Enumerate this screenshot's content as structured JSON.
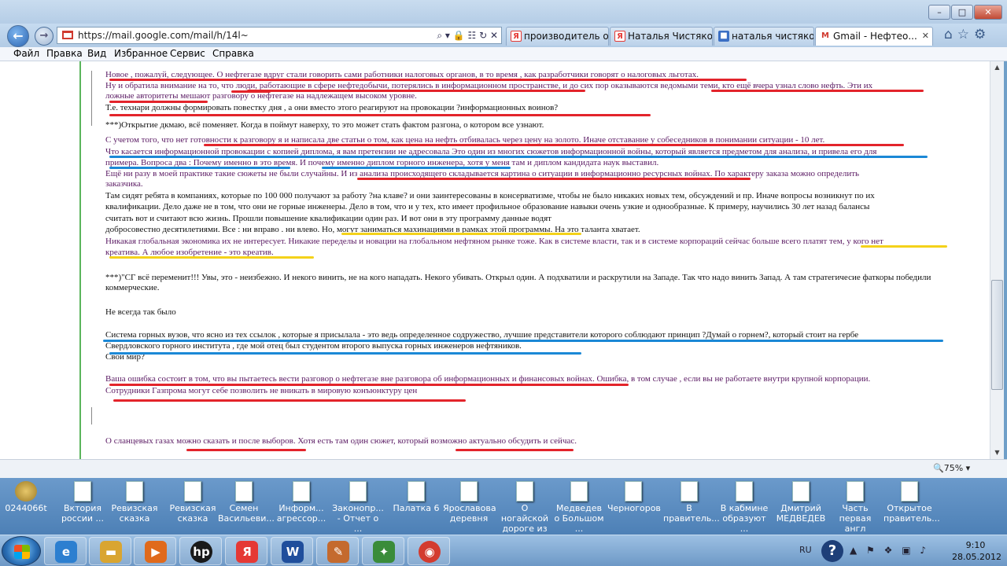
{
  "browser": {
    "url": "https://mail.google.com/mail/h/14l~",
    "addr_tools": "⌕ ▾ 🔒 ☷ ↻ ✕",
    "tabs": [
      {
        "label": "производитель об...",
        "fav": "Я",
        "favcolor": "#e53935"
      },
      {
        "label": "Наталья Чистяков...",
        "fav": "Я",
        "favcolor": "#e53935"
      },
      {
        "label": "наталья чистяков...",
        "fav": "■",
        "favcolor": "#3b6fc4"
      },
      {
        "label": "Gmail - Нефтео...",
        "fav": "M",
        "favcolor": "#d03a2f"
      }
    ],
    "tab_close": "✕",
    "nav_icons": "⌂☆⚙",
    "menu": [
      "Файл",
      "Правка",
      "Вид",
      "Избранное",
      "Сервис",
      "Справка"
    ],
    "window_buttons": {
      "min": "–",
      "max": "□",
      "close": "✕"
    },
    "zoom": "🔍75%  ▾"
  },
  "message": {
    "lines": [
      {
        "t": "Новое , пожалуй,  следующее.  О нефтегазе вдруг стали говорить   сами  работники налоговых органов, в то время ,   как разработчики  говорят о      налоговых льготах.",
        "c": "p"
      },
      {
        "t": "Ну и обратила  внимание на то, что   люди,      работающие  в  сфере  нефтедобычи,    потерялись в информационном пространстве,  и  до сих пор     оказываются ведомыми   теми, кто  ещё  вчера узнал  слово  нефть.   Эти их",
        "c": "p"
      },
      {
        "t": "ложные  авторитеты мешают  разговору  о  нефтегазе на     надлежащем высоком уровне.",
        "c": "p"
      },
      {
        "t": "Т.е.  технари   должны   формировать повестку дня , а они вместо этого    реагируют на провокации  ?информационных воинов?",
        "c": "b"
      },
      {
        "t": "***)Открытие        дкмаю, всё поменяет. Когда в        поймут наверху, то это может стать фактом разгона, о котором все узнают.",
        "c": "b"
      },
      {
        "t": " С учетом  того, что нет готовности к разговору я  и написала  две  статьи о том, как цена  на нефть отбивалась  через  цену  на  золото.  Иначе  отставание   у собеседников  в  понимании  ситуации  - 10 лет.",
        "c": "p"
      },
      {
        "t": " Что касается   информационной  провокации с  копией диплома, я   вам претензии не   адресовала  Это   один из многих сюжетов   информационной    войны, который  является предметом  для   анализа, и привела его  для",
        "c": "p"
      },
      {
        "t": "примера.  Вопроса два    :  Почему  именно  в  это  время.    И  почему именно диплом горного инженера, хотя у меня там и  диплом кандидата   наук  выставил.",
        "c": "p"
      },
      {
        "t": " Ещё  ни разу  в  моей  практике  такие сюжеты не были случайны. И из  анализа   происходящего   складывается   картина  о ситуации  в   информационно  ресурсных войнах. По характеру     заказа   можно  определить",
        "c": "p"
      },
      {
        "t": "заказчика.",
        "c": "p"
      },
      {
        "t": "Там сидят  ребята     в  компаниях,  которые   по   100 000   получают за работу    ?на  клаве? и они  заинтересованы  в    консерватизме, чтобы не было никаких новых тем,  обсуждений и    пр.     Иначе  вопросы   возникнут по их",
        "c": "b"
      },
      {
        "t": "квалификации.   Дело  даже   не  в том,  что они  не  горные   инженеры. Дело в том,   что    и    у    тех, кто имеет  профильное образование   навыки очень      узкие и однообразные.     К примеру,   научились  30 лет   назад  балансы",
        "c": "b"
      },
      {
        "t": "считать    вот  и  считают всю жизнь.   Прошли     повышение  квалификации один  раз.                                                                                                                          И вот  они     в  эту программу   данные   водят",
        "c": "b"
      },
      {
        "t": " добросовестно десятилетиями. Все  : ни вправо  . ни  влево.      Но,    могут  заниматься махинациями  в рамках этой  программы.    На это таланта  хватает.",
        "c": "b"
      },
      {
        "t": "Никакая  глобальная  экономика их не  интересует. Никакие переделы и новации на  глобальном нефтяном рынке  тоже.      Как в системе власти,    так и в системе     корпораций  сейчас больше всего       платят тем, у кого нет",
        "c": "p"
      },
      {
        "t": "креатива.    А  любое изобретение  - это креатив.",
        "c": "p"
      },
      {
        "t": " ***)\"СГ всё переменит!!! Увы, это - неизбежно. И некого винить, не на кого нападать. Некого убивать. Открыл один. А подхватили и раскрутили на Западе. Так что надо винить Запад. А там стратегичесие фаткоры победили",
        "c": "b"
      },
      {
        "t": "коммерческие.",
        "c": "b"
      },
      {
        "t": " Не всегда так было",
        "c": "b"
      },
      {
        "t": "Система горных   вузов, что ясно  из тех ссылок , которые  я присылала - это ведь    определенное содружество, лучшие  представители      которого   соблюдают принцип  ?Думай  о  горнем?, который   стоит  на   гербе",
        "c": "b"
      },
      {
        "t": " Свердловского горного    института   , где мой  отец   был студентом второго выпуска горных инженеров нефтяников.",
        "c": "b"
      },
      {
        "t": "  Свои   мир?",
        "c": "b"
      },
      {
        "t": "Ваша  ошибка  состоит  в том,   что   вы    пытаетесь вести разговор о нефтегазе вне разговора об информационных и финансовых войнах. Ошибка,    в  том   случае , если вы не работаете  внутри крупной   корпорации.",
        "c": "p"
      },
      {
        "t": "Сотрудники  Газпрома  могут себе  позволить не вникать в  мировую  конъюнктуру  цен",
        "c": "p"
      },
      {
        "t": "О  сланцевых  газах можно  сказать и после выборов.  Хотя    есть там один сюжет, который     возможно актуально обсудить и сейчас.",
        "c": "p"
      }
    ]
  },
  "desktop": {
    "icons": [
      {
        "label": "0244066t",
        "kind": "coin"
      },
      {
        "label": "Вктория россии ...",
        "kind": "doc"
      },
      {
        "label": "Ревизская сказка",
        "kind": "doc"
      },
      {
        "label": "Ревизская сказка",
        "kind": "doc"
      },
      {
        "label": "Семен Васильеви...",
        "kind": "doc"
      },
      {
        "label": "Информ... агрессор...",
        "kind": "doc"
      },
      {
        "label": "Законопр... - Отчет о ...",
        "kind": "doc"
      },
      {
        "label": "Палатка 6",
        "kind": "doc"
      },
      {
        "label": "Ярославова деревня",
        "kind": "doc"
      },
      {
        "label": "О ногайской дороге из ...",
        "kind": "doc"
      },
      {
        "label": "Медведев о Большом ...",
        "kind": "doc"
      },
      {
        "label": "Черногоров",
        "kind": "doc"
      },
      {
        "label": "В правитель...",
        "kind": "doc"
      },
      {
        "label": "В кабмине образуют ...",
        "kind": "doc"
      },
      {
        "label": "Дмитрий МЕДВЕДЕВ",
        "kind": "doc"
      },
      {
        "label": "Часть первая англ",
        "kind": "doc"
      },
      {
        "label": "Открытое правитель...",
        "kind": "doc"
      }
    ]
  },
  "taskbar": {
    "items": [
      {
        "name": "ie-taskbar-icon",
        "glyph": "e",
        "color": "#2c7fd0"
      },
      {
        "name": "explorer-taskbar-icon",
        "glyph": "▬",
        "color": "#d9a531"
      },
      {
        "name": "media-player-taskbar-icon",
        "glyph": "▶",
        "color": "#e06a1c"
      },
      {
        "name": "hp-taskbar-icon",
        "glyph": "hp",
        "color": "#1a1a1a"
      },
      {
        "name": "yandex-taskbar-icon",
        "glyph": "Я",
        "color": "#e53935"
      },
      {
        "name": "word-taskbar-icon",
        "glyph": "W",
        "color": "#1f4e9c"
      },
      {
        "name": "paint-taskbar-icon",
        "glyph": "✎",
        "color": "#c46a2e"
      },
      {
        "name": "network-taskbar-icon",
        "glyph": "✦",
        "color": "#3a8c3a"
      },
      {
        "name": "chrome-taskbar-icon",
        "glyph": "◉",
        "color": "#d33b2f"
      }
    ],
    "lang": "RU",
    "help": "?",
    "tray_icons": "▲ ⚑ ❖ ▣ ♪",
    "time": "9:10",
    "date": "28.05.2012"
  }
}
